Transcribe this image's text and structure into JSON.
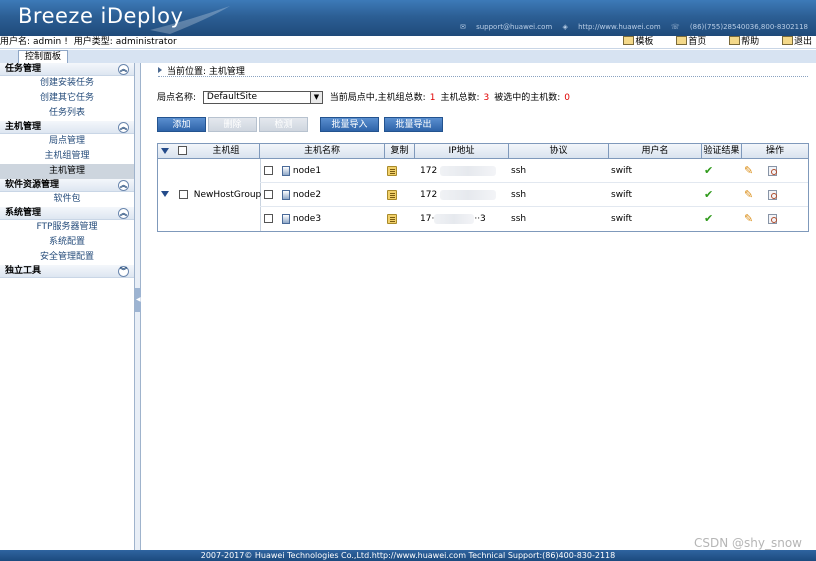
{
  "banner": {
    "logo": "Breeze iDeploy",
    "support": "support@huawei.com",
    "website": "http://www.huawei.com",
    "phone": "(86)(755)28540036,800-8302118"
  },
  "userbar": {
    "user_label": "用户名:",
    "user_value": "admin",
    "sep": "!",
    "type_label": "用户类型:",
    "type_value": "administrator",
    "links": [
      {
        "icon": "template-icon",
        "label": "模板"
      },
      {
        "icon": "home-icon",
        "label": "首页"
      },
      {
        "icon": "help-icon",
        "label": "帮助"
      },
      {
        "icon": "logout-icon",
        "label": "退出"
      }
    ]
  },
  "tabs": [
    {
      "label": "控制面板"
    }
  ],
  "sidebar": {
    "sections": [
      {
        "title": "任务管理",
        "toggle": "⌃",
        "items": [
          "创建安装任务",
          "创建其它任务",
          "任务列表"
        ]
      },
      {
        "title": "主机管理",
        "toggle": "⌃",
        "items": [
          "局点管理",
          "主机组管理",
          "主机管理"
        ]
      },
      {
        "title": "软件资源管理",
        "toggle": "⌃",
        "items": [
          "软件包"
        ]
      },
      {
        "title": "系统管理",
        "toggle": "⌃",
        "items": [
          "FTP服务器管理",
          "系统配置",
          "安全管理配置"
        ]
      },
      {
        "title": "独立工具",
        "toggle": "⌄",
        "items": []
      }
    ],
    "active_item": "主机管理"
  },
  "breadcrumb": {
    "label": "当前位置:",
    "value": "主机管理"
  },
  "site": {
    "label": "局点名称:",
    "selected": "DefaultSite",
    "summary_prefix": "当前局点中,主机组总数:",
    "group_count": "1",
    "host_label": "主机总数:",
    "host_count": "3",
    "selected_label": "被选中的主机数:",
    "selected_count": "0"
  },
  "buttons": {
    "add": "添加",
    "delete": "删除",
    "verify": "检测",
    "import": "批量导入",
    "export": "批量导出"
  },
  "table": {
    "headers": [
      "主机组",
      "主机名称",
      "复制",
      "IP地址",
      "协议",
      "用户名",
      "验证结果",
      "操作"
    ],
    "group_name": "NewHostGroup",
    "rows": [
      {
        "host": "node1",
        "ip": "172",
        "protocol": "ssh",
        "user": "swift"
      },
      {
        "host": "node2",
        "ip": "172",
        "protocol": "ssh",
        "user": "swift"
      },
      {
        "host": "node3",
        "ip": "17·",
        "ip_tail": "··3",
        "protocol": "ssh",
        "user": "swift"
      }
    ]
  },
  "footer": "2007-2017© Huawei Technologies Co.,Ltd.http://www.huawei.com   Technical Support:(86)400-830-2118",
  "watermark": "CSDN @shy_snow"
}
